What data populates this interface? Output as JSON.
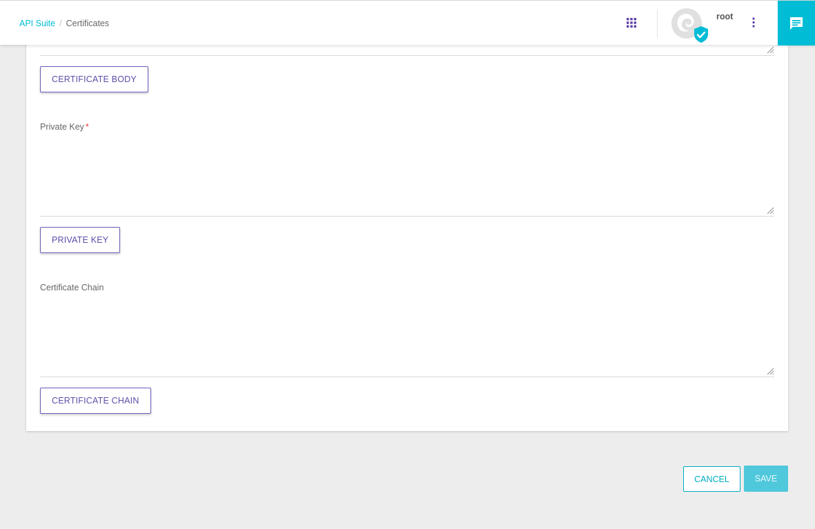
{
  "breadcrumb": {
    "root": "API Suite",
    "separator": "/",
    "current": "Certificates"
  },
  "header": {
    "apps_icon": "grid-apps-icon",
    "avatar_icon": "avatar-verified-icon",
    "username": "root",
    "menu_icon": "more-vertical-icon",
    "chat_icon": "chat-message-icon"
  },
  "form": {
    "certificate_body": {
      "button_label": "CERTIFICATE BODY",
      "value": ""
    },
    "private_key": {
      "label": "Private Key",
      "required_marker": "*",
      "value": "",
      "button_label": "PRIVATE KEY"
    },
    "certificate_chain": {
      "label": "Certificate Chain",
      "value": "",
      "button_label": "CERTIFICATE CHAIN"
    }
  },
  "actions": {
    "cancel_label": "CANCEL",
    "save_label": "SAVE"
  },
  "colors": {
    "accent": "#00bcd4",
    "primary_outline": "#6a5bb8",
    "required": "#e53935",
    "background": "#ededed"
  }
}
